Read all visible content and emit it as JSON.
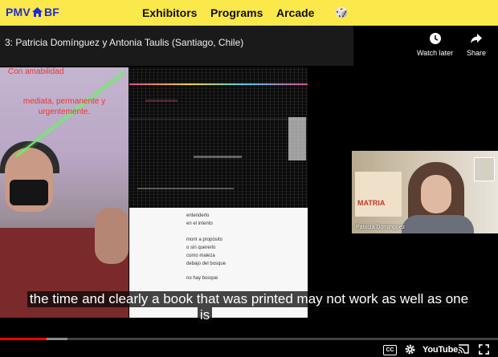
{
  "site": {
    "logo_left": "PMV",
    "logo_right": "BF",
    "nav": [
      "Exhibitors",
      "Programs",
      "Arcade"
    ],
    "dice_glyph": "🎲"
  },
  "player": {
    "title": "3: Patricia Domínguez y Antonia Taulis (Santiago, Chile)",
    "watch_later_label": "Watch later",
    "share_label": "Share",
    "cc_label": "CC",
    "brand_label": "YouTube",
    "progress_fraction": 0.094
  },
  "slide": {
    "poster_line1": "Con amabilidad",
    "poster_line2": "mediata, permanente y",
    "poster_line3": "urgentemente.",
    "poem_lines": [
      "entenderlo",
      "en el intento",
      "",
      "morir a propósito",
      "o sin quererlo",
      "como maleza",
      "debajo del bosque",
      "",
      "no hay bosque"
    ]
  },
  "webcam": {
    "poster_text": "MATRIA",
    "participant_name": "Patricia Domínguez"
  },
  "caption": {
    "line1": "the time and clearly a book that was printed may not work as well as one",
    "line2": "is"
  }
}
